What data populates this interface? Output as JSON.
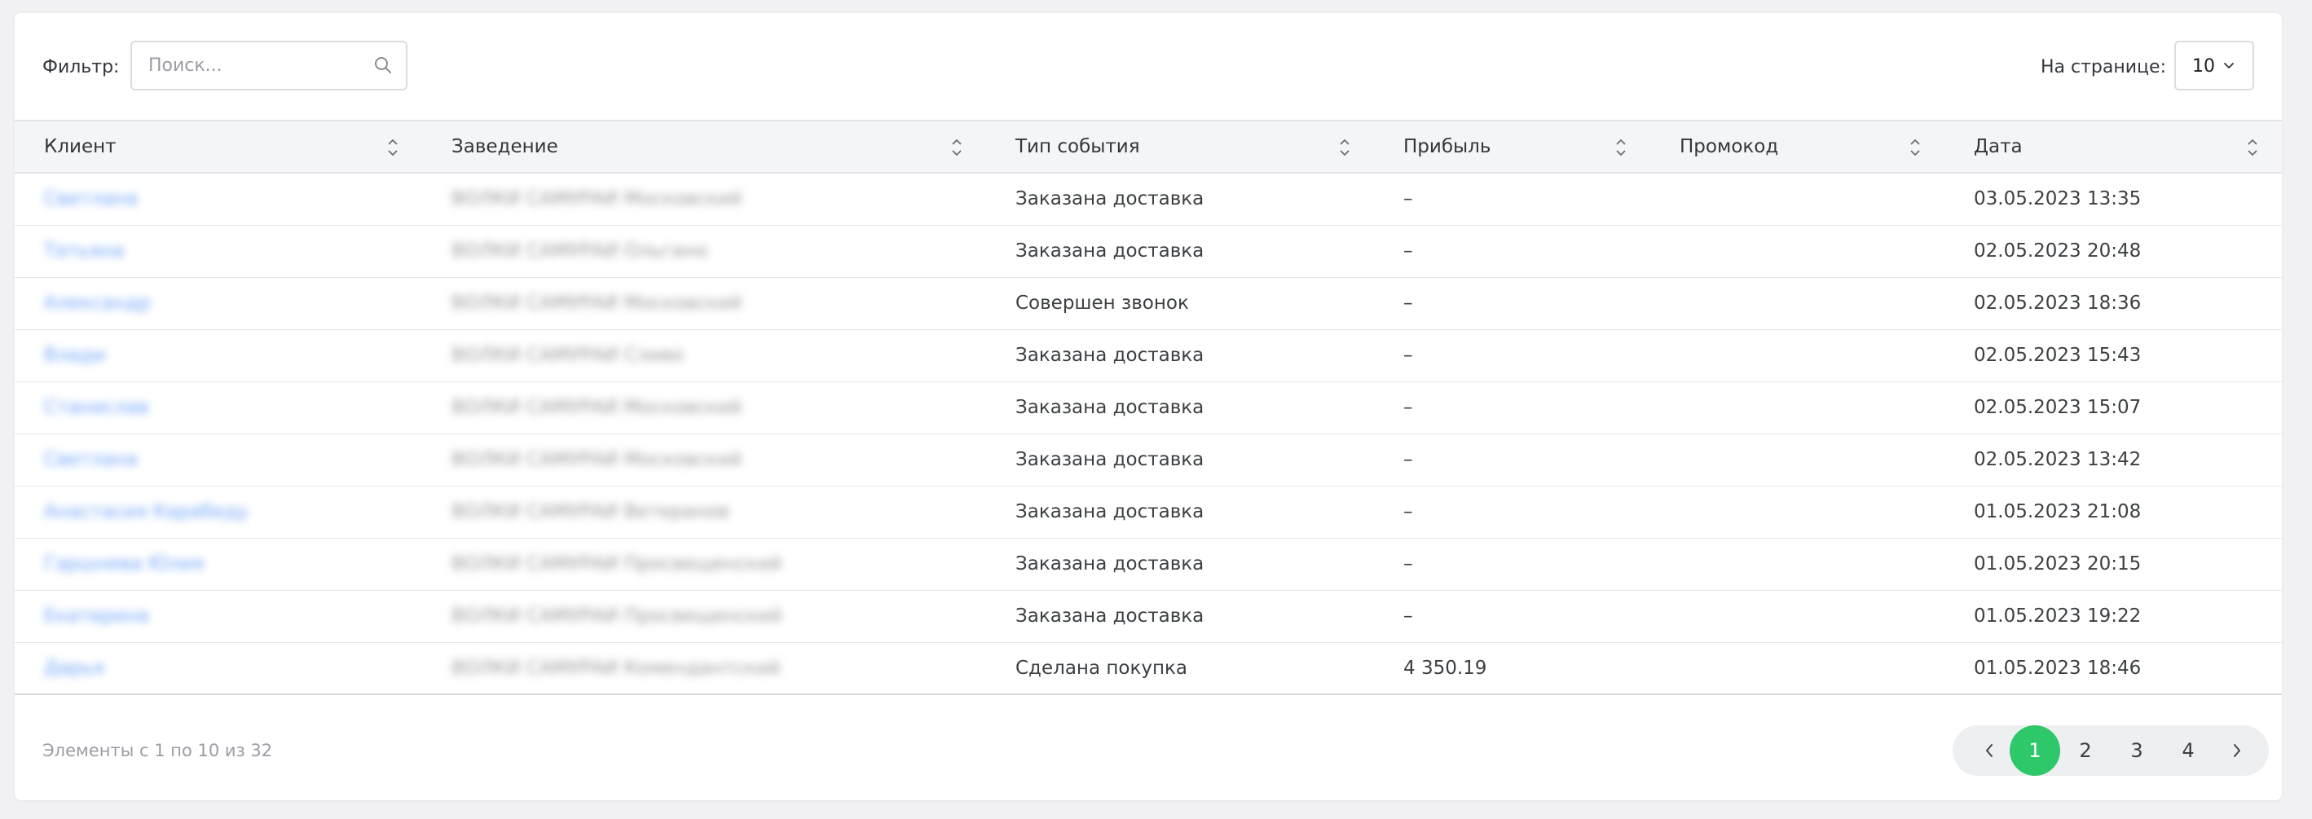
{
  "toolbar": {
    "filter_label": "Фильтр:",
    "search_placeholder": "Поиск...",
    "search_value": "",
    "per_page_label": "На странице:",
    "per_page_value": "10"
  },
  "table": {
    "columns": [
      "Клиент",
      "Заведение",
      "Тип события",
      "Прибыль",
      "Промокод",
      "Дата"
    ],
    "rows": [
      {
        "client": "Светлана",
        "venue": "ВОЛКИ САМУРАИ Московский",
        "event": "Заказана доставка",
        "profit": "–",
        "promo": "",
        "date": "03.05.2023 13:35"
      },
      {
        "client": "Татьяна",
        "venue": "ВОЛКИ САМУРАИ Ольгино",
        "event": "Заказана доставка",
        "profit": "–",
        "promo": "",
        "date": "02.05.2023 20:48"
      },
      {
        "client": "Александр",
        "venue": "ВОЛКИ САМУРАИ Московский",
        "event": "Совершен звонок",
        "profit": "–",
        "promo": "",
        "date": "02.05.2023 18:36"
      },
      {
        "client": "Влади",
        "venue": "ВОЛКИ САМУРАИ Сливо",
        "event": "Заказана доставка",
        "profit": "–",
        "promo": "",
        "date": "02.05.2023 15:43"
      },
      {
        "client": "Станислав",
        "venue": "ВОЛКИ САМУРАИ Московский",
        "event": "Заказана доставка",
        "profit": "–",
        "promo": "",
        "date": "02.05.2023 15:07"
      },
      {
        "client": "Светлана",
        "venue": "ВОЛКИ САМУРАИ Московский",
        "event": "Заказана доставка",
        "profit": "–",
        "promo": "",
        "date": "02.05.2023 13:42"
      },
      {
        "client": "Анастасия Карабеду",
        "venue": "ВОЛКИ САМУРАИ Ветеранов",
        "event": "Заказана доставка",
        "profit": "–",
        "promo": "",
        "date": "01.05.2023 21:08"
      },
      {
        "client": "Гаршнева Юлия",
        "venue": "ВОЛКИ САМУРАИ Просвещенский",
        "event": "Заказана доставка",
        "profit": "–",
        "promo": "",
        "date": "01.05.2023 20:15"
      },
      {
        "client": "Екатерина",
        "venue": "ВОЛКИ САМУРАИ Просвещенский",
        "event": "Заказана доставка",
        "profit": "–",
        "promo": "",
        "date": "01.05.2023 19:22"
      },
      {
        "client": "Дарья",
        "venue": "ВОЛКИ САМУРАИ Комендантский",
        "event": "Сделана покупка",
        "profit": "4 350.19",
        "promo": "",
        "date": "01.05.2023 18:46"
      }
    ]
  },
  "footer": {
    "info": "Элементы с 1 по 10 из 32",
    "pages": [
      "1",
      "2",
      "3",
      "4"
    ],
    "active_page": "1"
  },
  "icons": {
    "search": "search-icon",
    "sort": "sort-icon",
    "chevron_down": "chevron-down-icon",
    "prev": "chevron-left-icon",
    "next": "chevron-right-icon"
  },
  "colors": {
    "accent": "#2ec76a",
    "link": "#2f7cf6",
    "header_bg": "#f4f5f7"
  }
}
